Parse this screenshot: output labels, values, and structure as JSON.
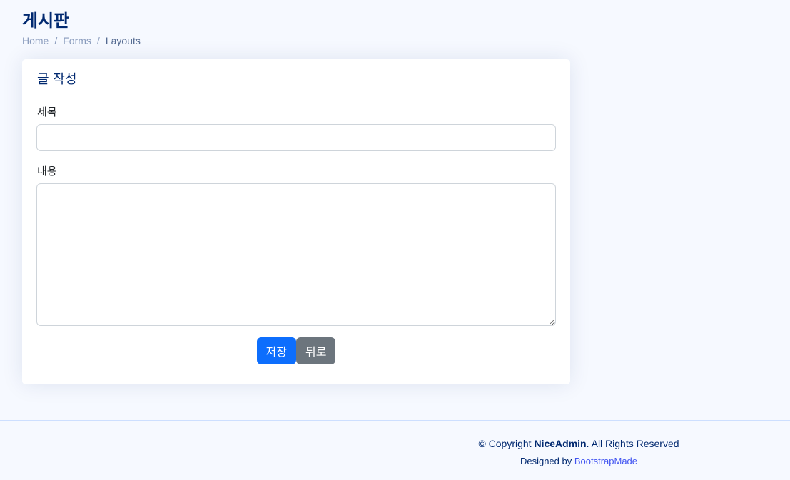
{
  "page": {
    "title": "게시판",
    "breadcrumb": [
      "Home",
      "Forms",
      "Layouts"
    ]
  },
  "card": {
    "title": "글 작성",
    "title_label": "제목",
    "title_value": "",
    "content_label": "내용",
    "content_value": "",
    "save_label": "저장",
    "back_label": "뒤로"
  },
  "footer": {
    "copyright_prefix": "© Copyright ",
    "brand": "NiceAdmin",
    "copyright_suffix": ". All Rights Reserved",
    "designed_by": "Designed by ",
    "designer": "BootstrapMade"
  },
  "colors": {
    "title": "#012970",
    "primary": "#0d6efd",
    "secondary": "#6c757d",
    "link": "#4154f1",
    "background": "#f6f9ff"
  }
}
